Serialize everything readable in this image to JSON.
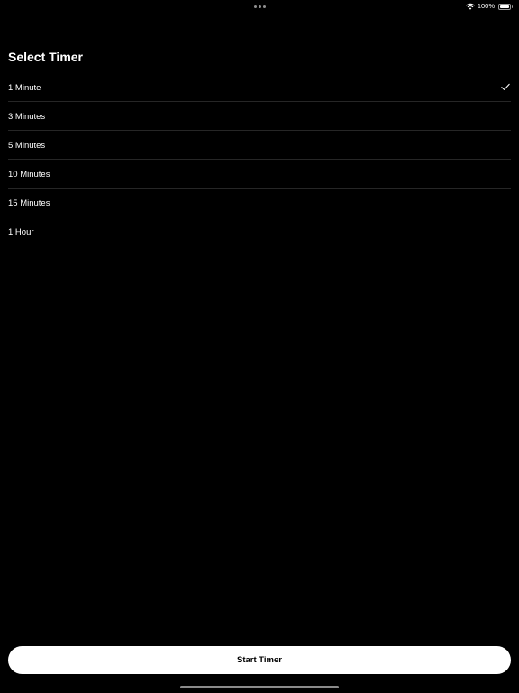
{
  "status_bar": {
    "battery_percent": "100%",
    "battery_level": 1.0,
    "icons": [
      "multitasking-dots-icon",
      "wifi-icon",
      "battery-icon"
    ]
  },
  "screen": {
    "title": "Select Timer"
  },
  "timer_options": [
    {
      "label": "1 Minute",
      "selected": true
    },
    {
      "label": "3 Minutes",
      "selected": false
    },
    {
      "label": "5 Minutes",
      "selected": false
    },
    {
      "label": "10 Minutes",
      "selected": false
    },
    {
      "label": "15 Minutes",
      "selected": false
    },
    {
      "label": "1 Hour",
      "selected": false
    }
  ],
  "actions": {
    "start_label": "Start Timer"
  },
  "colors": {
    "background": "#000000",
    "text": "#ffffff",
    "separator": "#262626",
    "button_background": "#ffffff",
    "button_text": "#000000"
  }
}
